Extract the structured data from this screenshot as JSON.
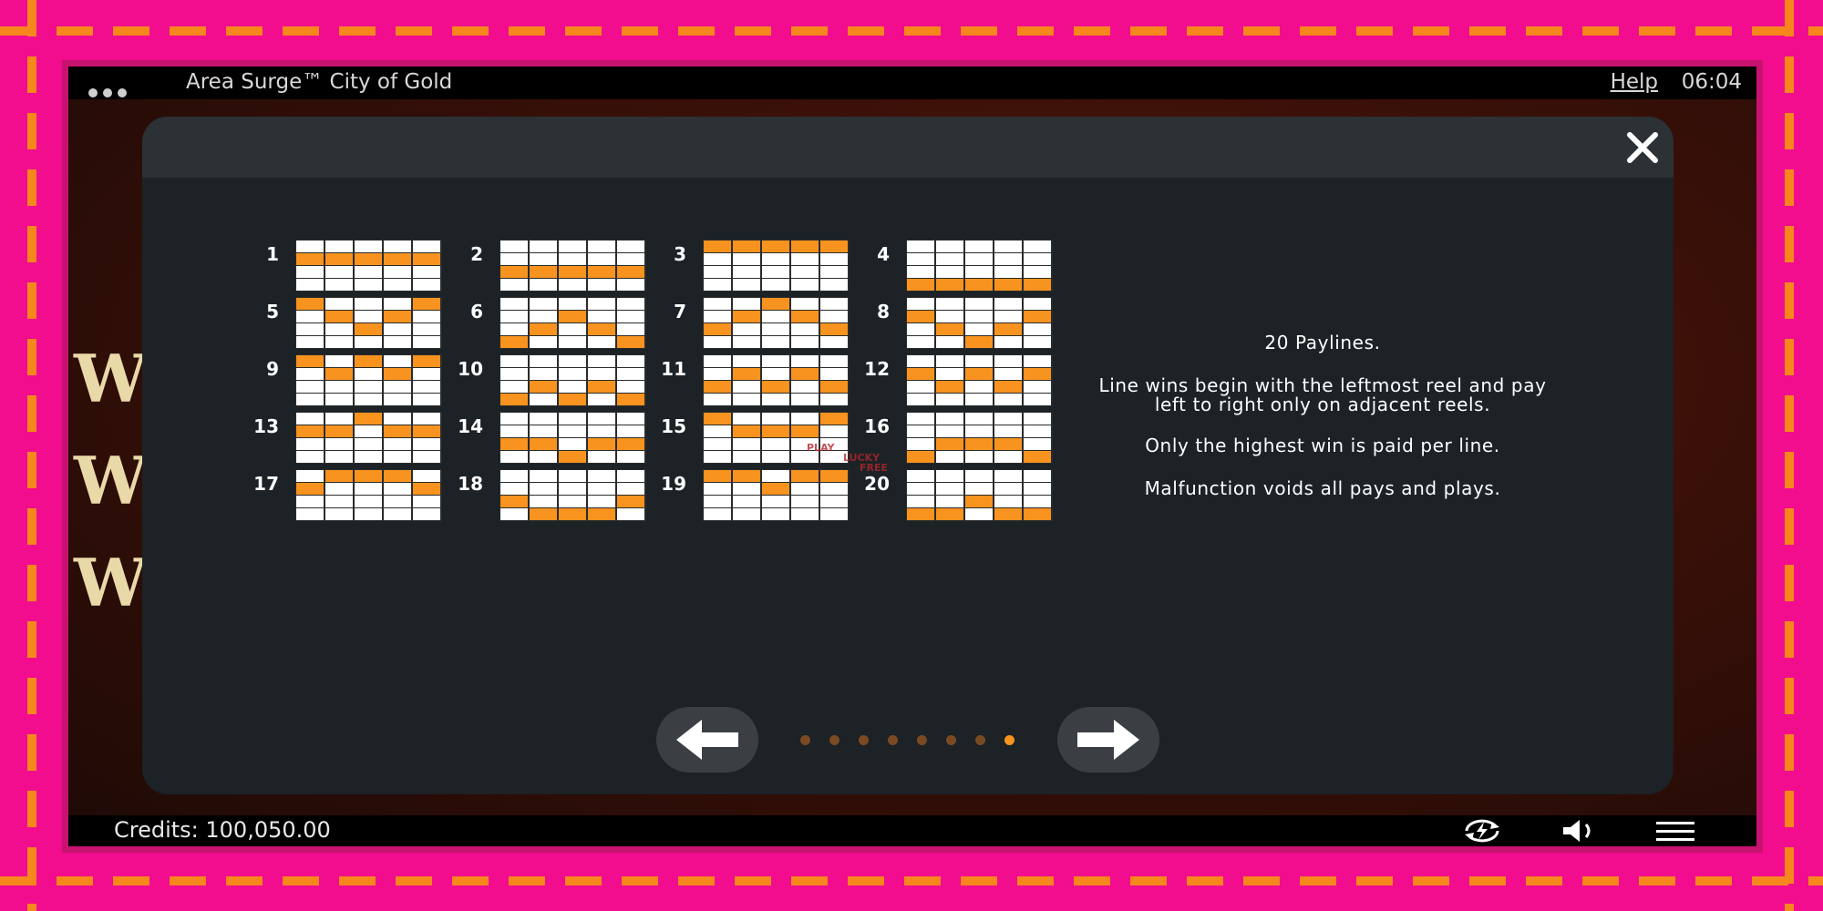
{
  "header": {
    "app_title": "Area Surge™ City of Gold",
    "help_label": "Help",
    "time": "06:04"
  },
  "footer": {
    "credits_text": "Credits: 100,050.00"
  },
  "modal": {
    "paylines": [
      {
        "label": "1",
        "rows": [
          1,
          1,
          1,
          1,
          1
        ]
      },
      {
        "label": "2",
        "rows": [
          2,
          2,
          2,
          2,
          2
        ]
      },
      {
        "label": "3",
        "rows": [
          0,
          0,
          0,
          0,
          0
        ]
      },
      {
        "label": "4",
        "rows": [
          3,
          3,
          3,
          3,
          3
        ]
      },
      {
        "label": "5",
        "rows": [
          0,
          1,
          2,
          1,
          0
        ]
      },
      {
        "label": "6",
        "rows": [
          3,
          2,
          1,
          2,
          3
        ]
      },
      {
        "label": "7",
        "rows": [
          2,
          1,
          0,
          1,
          2
        ]
      },
      {
        "label": "8",
        "rows": [
          1,
          2,
          3,
          2,
          1
        ]
      },
      {
        "label": "9",
        "rows": [
          0,
          1,
          0,
          1,
          0
        ]
      },
      {
        "label": "10",
        "rows": [
          3,
          2,
          3,
          2,
          3
        ]
      },
      {
        "label": "11",
        "rows": [
          2,
          1,
          2,
          1,
          2
        ]
      },
      {
        "label": "12",
        "rows": [
          1,
          2,
          1,
          2,
          1
        ]
      },
      {
        "label": "13",
        "rows": [
          1,
          1,
          0,
          1,
          1
        ]
      },
      {
        "label": "14",
        "rows": [
          2,
          2,
          3,
          2,
          2
        ]
      },
      {
        "label": "15",
        "rows": [
          0,
          1,
          1,
          1,
          0
        ]
      },
      {
        "label": "16",
        "rows": [
          3,
          2,
          2,
          2,
          3
        ]
      },
      {
        "label": "17",
        "rows": [
          1,
          0,
          0,
          0,
          1
        ]
      },
      {
        "label": "18",
        "rows": [
          2,
          3,
          3,
          3,
          2
        ]
      },
      {
        "label": "19",
        "rows": [
          0,
          0,
          1,
          0,
          0
        ]
      },
      {
        "label": "20",
        "rows": [
          3,
          3,
          2,
          3,
          3
        ]
      }
    ],
    "info": {
      "paylines_count": "20 Paylines.",
      "rule_line_wins": "Line wins begin with the leftmost reel and pay left to right only on adjacent reels.",
      "rule_highest_win": "Only the highest win is paid per line.",
      "rule_malfunction": "Malfunction voids all pays and plays."
    },
    "pager": {
      "total": 8,
      "active": 8
    },
    "watermark_text": [
      "PLAY",
      "LUCKY",
      "FREE"
    ]
  },
  "colors": {
    "border_pink": "#f20d8f",
    "border_dash": "#f7871c",
    "payline_highlight": "#f7931e",
    "modal_bg": "#1c2226"
  },
  "icons": [
    "menu-dots-icon",
    "close-icon",
    "arrow-left-icon",
    "arrow-right-icon",
    "autoplay-icon",
    "speaker-icon",
    "hamburger-menu-icon"
  ]
}
